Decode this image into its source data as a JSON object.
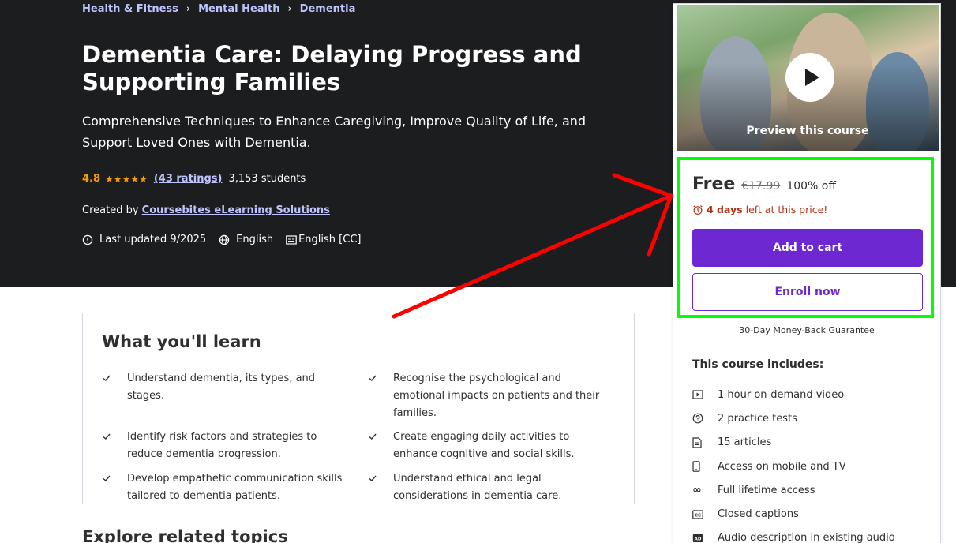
{
  "breadcrumb": [
    {
      "label": "Health & Fitness"
    },
    {
      "label": "Mental Health"
    },
    {
      "label": "Dementia"
    }
  ],
  "course": {
    "title": "Dementia Care: Delaying Progress and Supporting Families",
    "subtitle": "Comprehensive Techniques to Enhance Caregiving, Improve Quality of Life, and Support Loved Ones with Dementia.",
    "rating": "4.8",
    "stars": "★★★★★",
    "ratings_count": "(43 ratings)",
    "students": "3,153 students",
    "created_by_label": "Created by",
    "author": "Coursebites eLearning Solutions",
    "last_updated": "Last updated 9/2025",
    "language": "English",
    "captions": "English [CC]"
  },
  "learn": {
    "title": "What you'll learn",
    "items": [
      "Understand dementia, its types, and stages.",
      "Recognise the psychological and emotional impacts on patients and their families.",
      "Identify risk factors and strategies to reduce dementia progression.",
      "Create engaging daily activities to enhance cognitive and social skills.",
      "Develop empathetic communication skills tailored to dementia patients.",
      "Understand ethical and legal considerations in dementia care."
    ]
  },
  "explore_title": "Explore related topics",
  "sidebar": {
    "preview_label": "Preview this course",
    "price": "Free",
    "original_price": "€17.99",
    "discount": "100% off",
    "timer_bold": "4 days",
    "timer_text": "left at this price!",
    "add_to_cart": "Add to cart",
    "enroll_now": "Enroll now",
    "guarantee": "30-Day Money-Back Guarantee",
    "includes_title": "This course includes:",
    "includes": [
      {
        "icon": "video-icon",
        "label": "1 hour on-demand video"
      },
      {
        "icon": "quiz-icon",
        "label": "2 practice tests"
      },
      {
        "icon": "article-icon",
        "label": "15 articles"
      },
      {
        "icon": "mobile-icon",
        "label": "Access on mobile and TV"
      },
      {
        "icon": "infinity-icon",
        "label": "Full lifetime access"
      },
      {
        "icon": "cc-icon",
        "label": "Closed captions"
      },
      {
        "icon": "audio-description-icon",
        "label": "Audio description in existing audio"
      }
    ]
  },
  "colors": {
    "hero_bg": "#1c1d1f",
    "accent_purple": "#6d28d2",
    "link_lavender": "#c0c4fc",
    "star_orange": "#f69c08",
    "timer_red": "#b32d0f",
    "annotation_green": "#00ff00",
    "annotation_red": "#ff0000"
  }
}
